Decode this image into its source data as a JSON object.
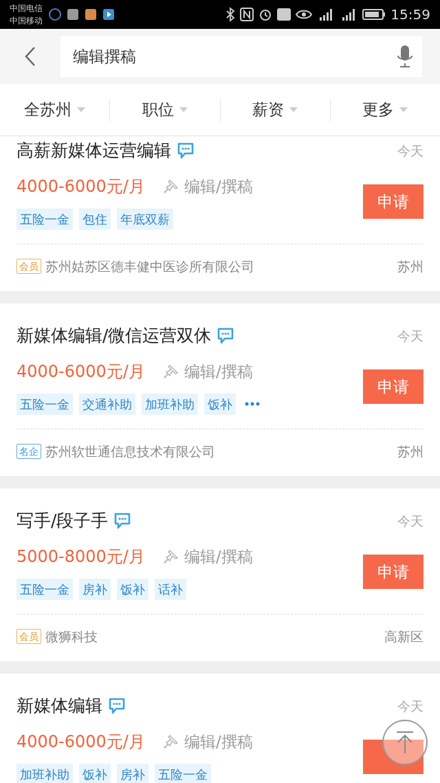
{
  "status_bar": {
    "carriers": [
      "中国电信",
      "中国移动"
    ],
    "time": "15:59"
  },
  "search": {
    "value": "编辑撰稿"
  },
  "filters": [
    {
      "label": "全苏州"
    },
    {
      "label": "职位"
    },
    {
      "label": "薪资"
    },
    {
      "label": "更多"
    }
  ],
  "jobs": [
    {
      "title": "高薪新媒体运营编辑",
      "date": "今天",
      "salary": "4000-6000元/月",
      "category": "编辑/撰稿",
      "tags": [
        "五险一金",
        "包住",
        "年底双薪"
      ],
      "more_tags": false,
      "badge": {
        "kind": "member",
        "label": "会员"
      },
      "company": "苏州姑苏区德丰健中医诊所有限公司",
      "location": "苏州",
      "apply": "申请"
    },
    {
      "title": "新媒体编辑/微信运营双休",
      "date": "今天",
      "salary": "4000-6000元/月",
      "category": "编辑/撰稿",
      "tags": [
        "五险一金",
        "交通补助",
        "加班补助",
        "饭补"
      ],
      "more_tags": true,
      "badge": {
        "kind": "famous",
        "label": "名企"
      },
      "company": "苏州软世通信息技术有限公司",
      "location": "苏州",
      "apply": "申请"
    },
    {
      "title": "写手/段子手",
      "date": "今天",
      "salary": "5000-8000元/月",
      "category": "编辑/撰稿",
      "tags": [
        "五险一金",
        "房补",
        "饭补",
        "话补"
      ],
      "more_tags": false,
      "badge": {
        "kind": "member",
        "label": "会员"
      },
      "company": "微狮科技",
      "location": "高新区",
      "apply": "申请"
    },
    {
      "title": "新媒体编辑",
      "date": "今天",
      "salary": "4000-6000元/月",
      "category": "编辑/撰稿",
      "tags": [
        "加班补助",
        "饭补",
        "房补",
        "五险一金"
      ],
      "more_tags": false
    }
  ]
}
